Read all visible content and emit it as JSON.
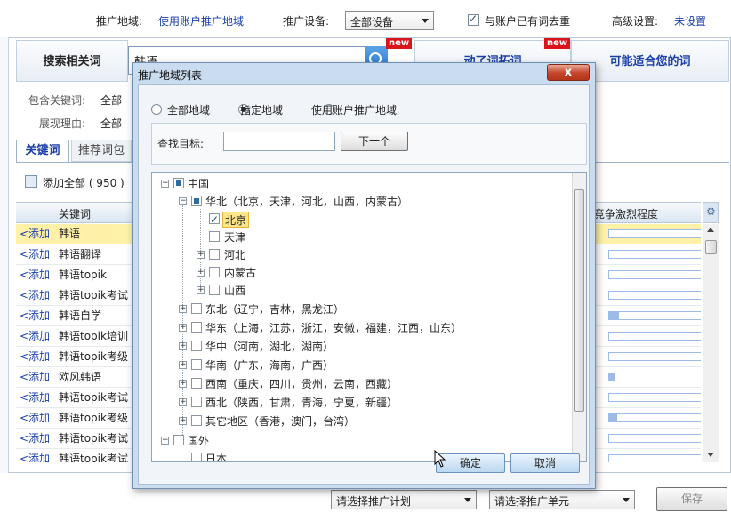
{
  "topbar": {
    "region_label": "推广地域:",
    "region_value": "使用账户推广地域",
    "device_label": "推广设备:",
    "device_value": "全部设备",
    "dedupe_label": "与账户已有词去重",
    "advanced_label": "高级设置:",
    "advanced_value": "未设置"
  },
  "background": {
    "search_tab": "搜索相关词",
    "search_value": "韩语",
    "new_badge": "new",
    "suggest_tab": "动了词拓词",
    "suitable_tab": "可能适合您的词",
    "include_label": "包含关键词:",
    "include_value": "全部",
    "reason_label": "展现理由:",
    "reason_value": "全部",
    "keyword_tab": "关键词",
    "recommend_tab": "推荐词包",
    "add_all": "添加全部 ( 950 )",
    "col_keyword": "关键词",
    "col_competition": "竞争激烈程度",
    "add_label": "<添加",
    "rows": [
      "韩语",
      "韩语翻译",
      "韩语topik",
      "韩语topik考试",
      "韩语自学",
      "韩语topik培训",
      "韩语topik考级",
      "欧风韩语",
      "韩语topik考试",
      "韩语topik考级",
      "韩语topik考试",
      "韩语topik考试"
    ],
    "competition": [
      0.0,
      0.0,
      0.0,
      0.0,
      0.1,
      0.0,
      0.0,
      0.05,
      0.0,
      0.08,
      0.0,
      0.0
    ],
    "plan_select": "请选择推广计划",
    "unit_select": "请选择推广单元",
    "save_button": "保存"
  },
  "dialog": {
    "title": "推广地域列表",
    "close": "x",
    "radio_all": "全部地域",
    "radio_specified": "指定地域",
    "radio_account": "使用账户推广地域",
    "search_label": "查找目标:",
    "search_value": "",
    "next_button": "下一个",
    "tree": {
      "china": "中国",
      "huabei": "华北（北京，天津，河北，山西，内蒙古）",
      "beijing": "北京",
      "tianjin": "天津",
      "hebei": "河北",
      "neimenggu": "内蒙古",
      "shanxi": "山西",
      "dongbei": "东北（辽宁，吉林，黑龙江）",
      "huadong": "华东（上海，江苏，浙江，安徽，福建，江西，山东）",
      "huazhong": "华中（河南，湖北，湖南）",
      "huanan": "华南（广东，海南，广西）",
      "xinan": "西南（重庆，四川，贵州，云南，西藏）",
      "xibei": "西北（陕西，甘肃，青海，宁夏，新疆）",
      "other": "其它地区（香港，澳门，台湾）",
      "foreign": "国外",
      "japan": "日本"
    },
    "ok_button": "确定",
    "cancel_button": "取消"
  }
}
